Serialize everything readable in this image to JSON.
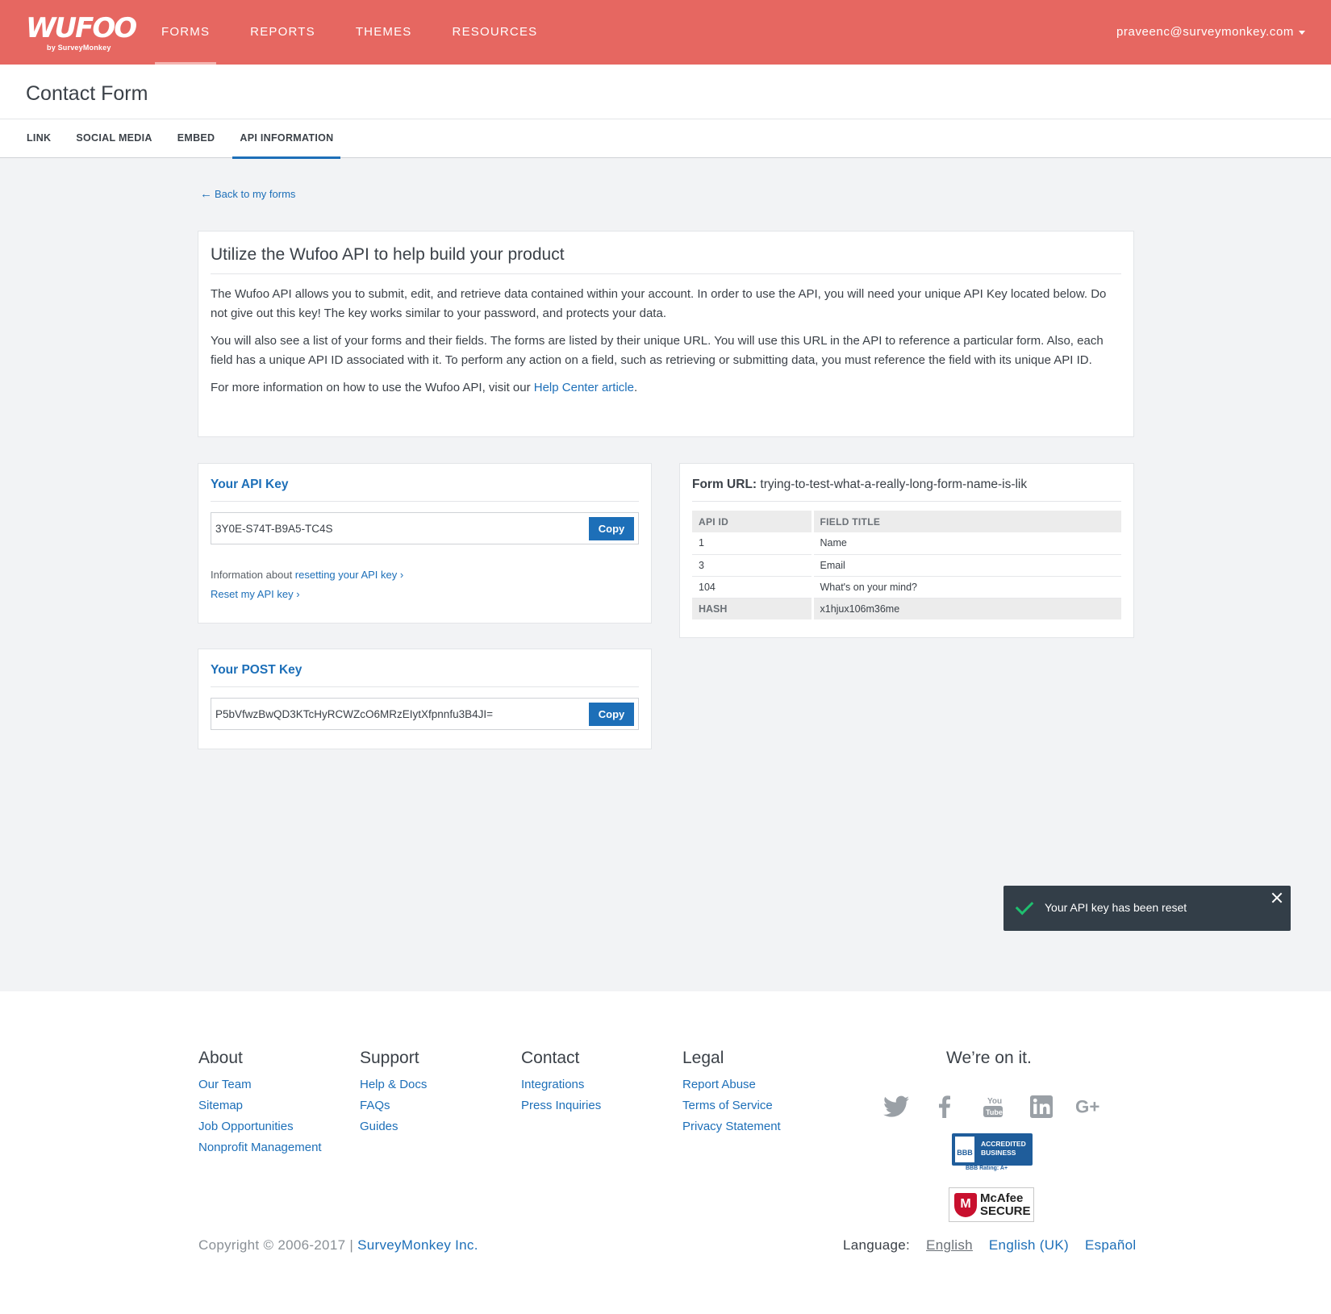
{
  "brand": {
    "logo_text": "WUFOO",
    "tagline": "by SurveyMonkey"
  },
  "nav": {
    "items": [
      {
        "label": "FORMS",
        "active": true
      },
      {
        "label": "REPORTS"
      },
      {
        "label": "THEMES"
      },
      {
        "label": "RESOURCES"
      }
    ],
    "user_email": "praveenc@surveymonkey.com"
  },
  "page": {
    "title": "Contact Form"
  },
  "tabs": [
    {
      "label": "LINK"
    },
    {
      "label": "SOCIAL MEDIA"
    },
    {
      "label": "EMBED"
    },
    {
      "label": "API INFORMATION",
      "active": true
    }
  ],
  "back_link": {
    "arrow": "←",
    "label": "Back to my forms"
  },
  "intro": {
    "heading": "Utilize the Wufoo API to help build your product",
    "p1": "The Wufoo API allows you to submit, edit, and retrieve data contained within your account. In order to use the API, you will need your unique API Key located below. Do not give out this key! The key works similar to your password, and protects your data.",
    "p2": "You will also see a list of your forms and their fields. The forms are listed by their unique URL. You will use this URL in the API to reference a particular form. Also, each field has a unique API ID associated with it. To perform any action on a field, such as retrieving or submitting data, you must reference the field with its unique API ID.",
    "p3_prefix": "For more information on how to use the Wufoo API, visit our ",
    "p3_link": "Help Center article",
    "p3_suffix": "."
  },
  "api_key": {
    "heading": "Your API Key",
    "value": "3Y0E-S74T-B9A5-TC4S",
    "copy_label": "Copy",
    "info_prefix": "Information about ",
    "info_link": "resetting your API key ›",
    "reset_link": "Reset my API key ›"
  },
  "post_key": {
    "heading": "Your POST Key",
    "value": "P5bVfwzBwQD3KTcHyRCWZcO6MRzEIytXfpnnfu3B4JI=",
    "copy_label": "Copy"
  },
  "form_info": {
    "url_label": "Form URL:",
    "url_value": "trying-to-test-what-a-really-long-form-name-is-lik",
    "headers": [
      "API ID",
      "FIELD TITLE"
    ],
    "rows": [
      {
        "id": "1",
        "title": "Name"
      },
      {
        "id": "3",
        "title": "Email"
      },
      {
        "id": "104",
        "title": "What's on your mind?"
      }
    ],
    "hash_label": "HASH",
    "hash_value": "x1hjux106m36me"
  },
  "toast": {
    "message": "Your API key has been reset",
    "status_color": "#1fbf6f"
  },
  "footer": {
    "about": {
      "heading": "About",
      "links": [
        "Our Team",
        "Sitemap",
        "Job Opportunities",
        "Nonprofit Management"
      ]
    },
    "support": {
      "heading": "Support",
      "links": [
        "Help & Docs",
        "FAQs",
        "Guides"
      ]
    },
    "contact": {
      "heading": "Contact",
      "links": [
        "Integrations",
        "Press Inquiries"
      ]
    },
    "legal": {
      "heading": "Legal",
      "links": [
        "Report Abuse",
        "Terms of Service",
        "Privacy Statement"
      ]
    },
    "tagline": "We’re on it.",
    "social": [
      "twitter-icon",
      "facebook-icon",
      "youtube-icon",
      "linkedin-icon",
      "google-plus-icon"
    ],
    "bbb": {
      "seal": "BBB",
      "line1": "ACCREDITED",
      "line2": "BUSINESS",
      "rating": "BBB Rating: A+"
    },
    "mcafee": {
      "line1": "McAfee",
      "line2": "SECURE"
    },
    "copyright_prefix": "Copyright © 2006-2017 | ",
    "copyright_link": "SurveyMonkey Inc.",
    "language_label": "Language:",
    "languages": [
      {
        "label": "English",
        "active": true
      },
      {
        "label": "English (UK)"
      },
      {
        "label": "Español"
      }
    ]
  },
  "colors": {
    "header": "#e66761",
    "accent": "#1d6fb8",
    "toast_bg": "#333e48"
  }
}
